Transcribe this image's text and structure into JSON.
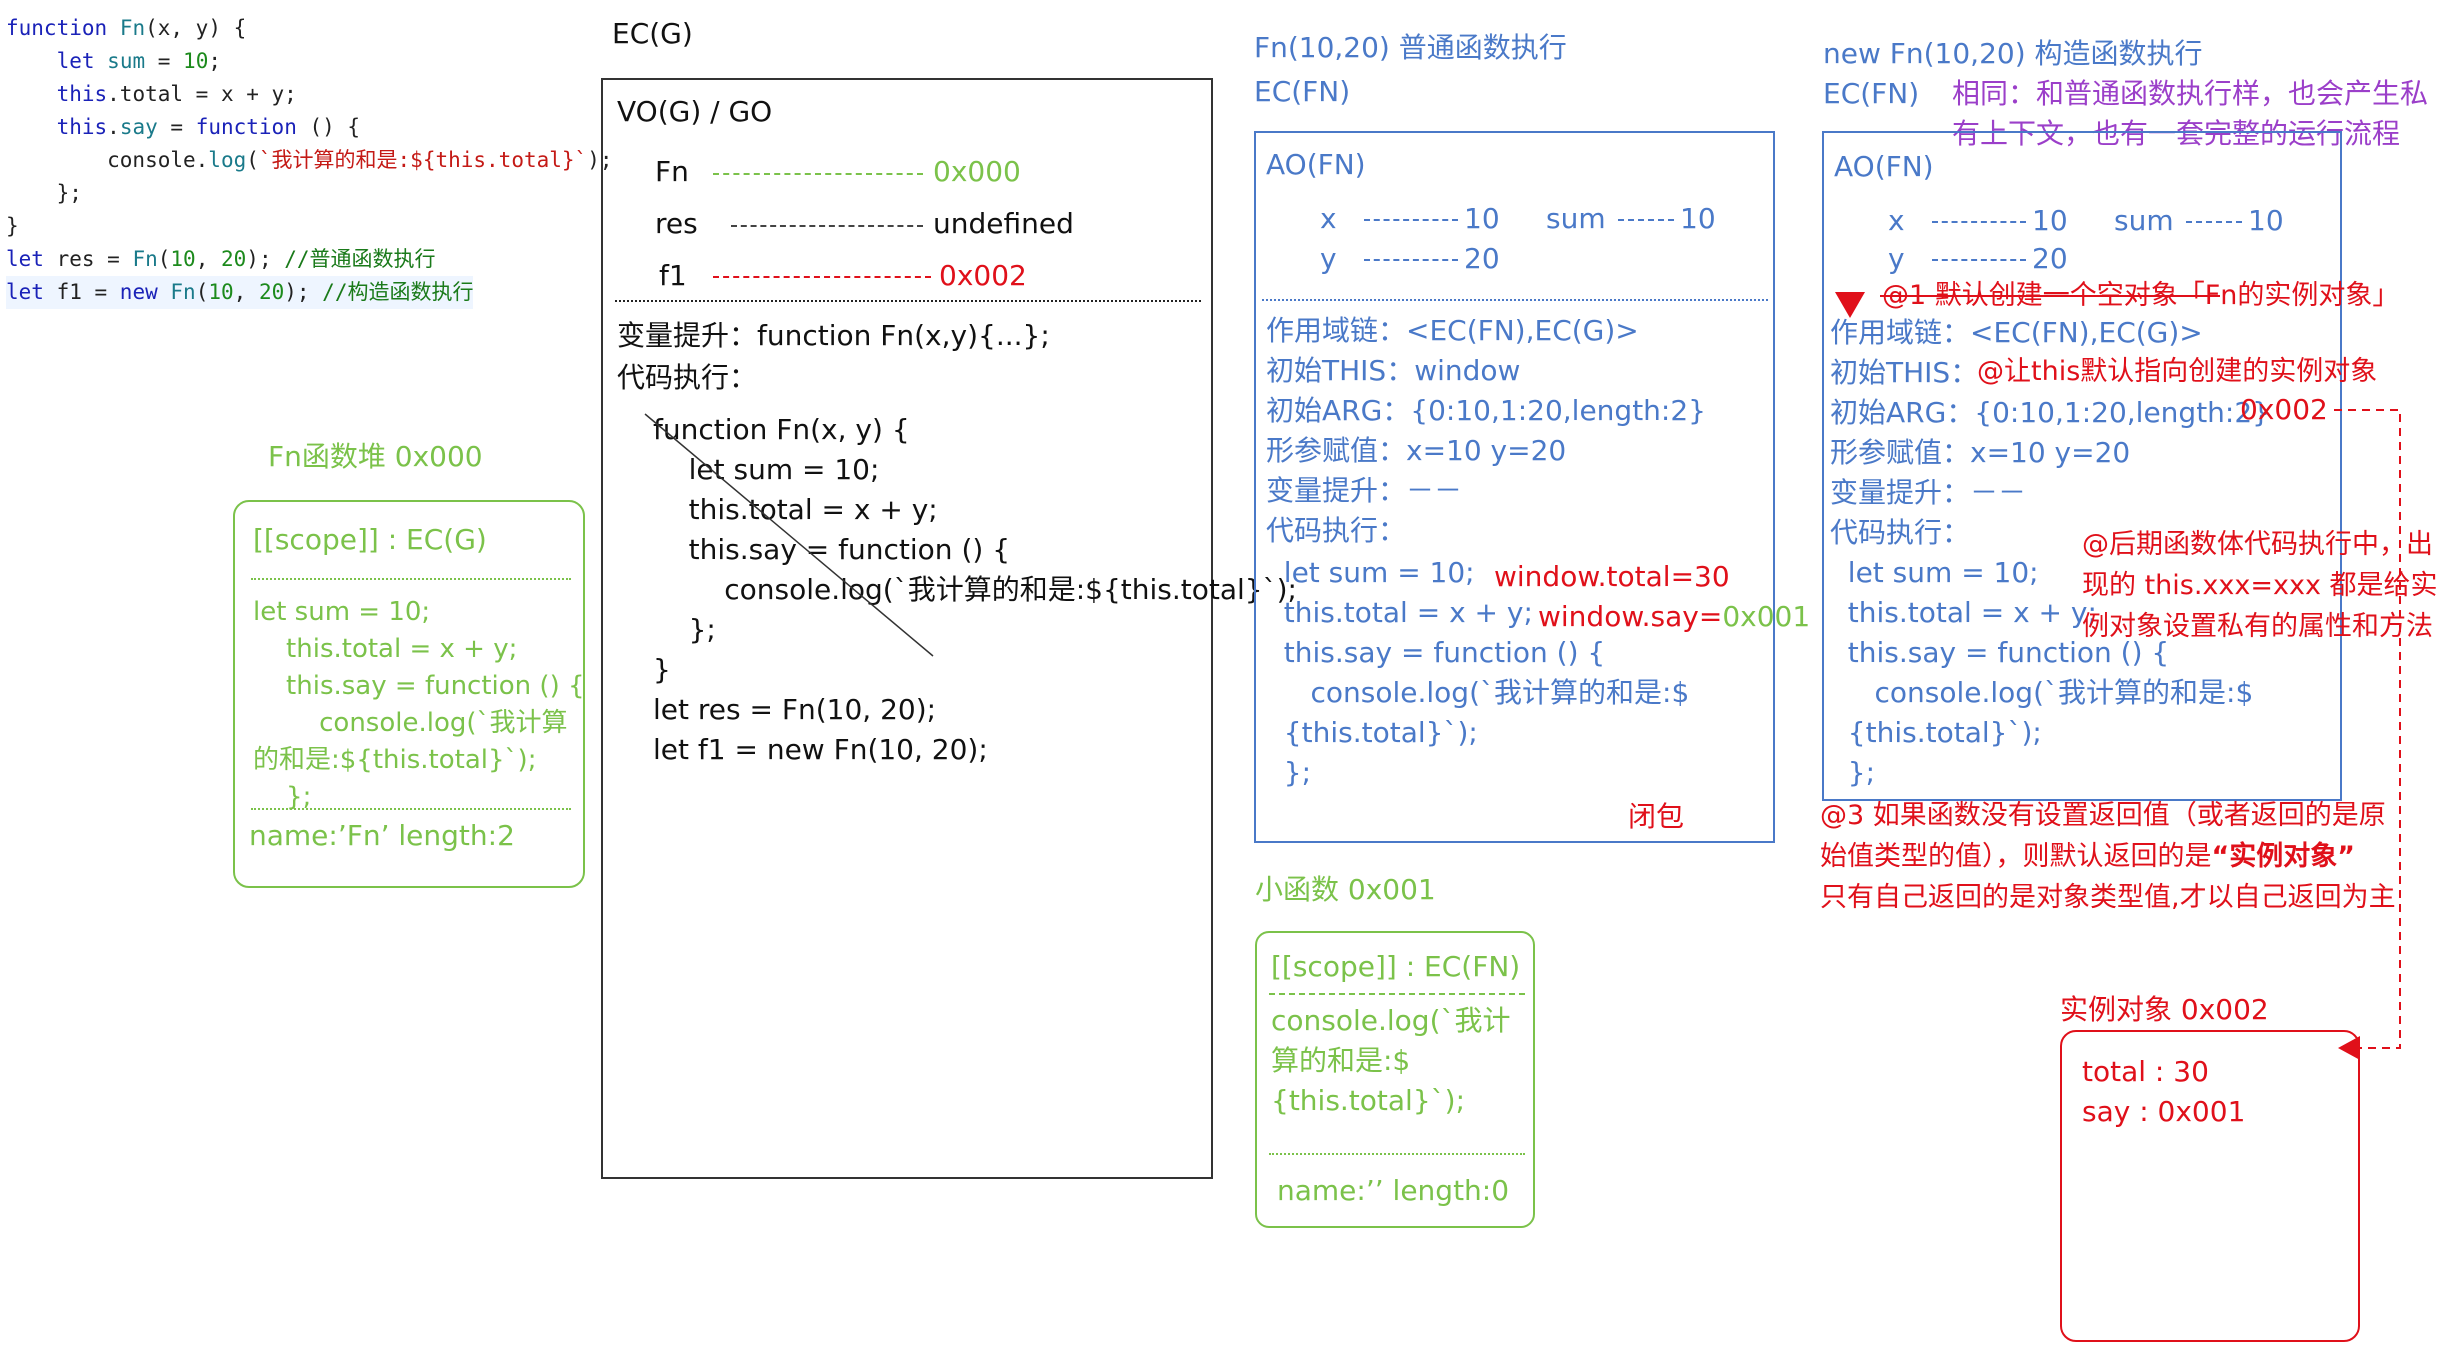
{
  "code": {
    "lines": [
      "function Fn(x, y) {",
      "    let sum = 10;",
      "    this.total = x + y;",
      "    this.say = function () {",
      "        console.log(`我计算的和是:${this.total}`);",
      "    };",
      "}",
      "let res = Fn(10, 20); //普通函数执行",
      "let f1 = new Fn(10, 20); //构造函数执行"
    ]
  },
  "ecg": {
    "title": "EC(G)",
    "vo_title": "VO(G) / GO",
    "vars": [
      {
        "name": "Fn",
        "value": "0x000"
      },
      {
        "name": "res",
        "value": "undefined"
      },
      {
        "name": "f1",
        "value": "0x002"
      }
    ],
    "hoist": "变量提升：function Fn(x,y){...};",
    "exec_label": "代码执行：",
    "exec_code": "function Fn(x, y) {\n    let sum = 10;\n    this.total = x + y;\n    this.say = function () {\n        console.log(`我计算的和是:${this.total}`);\n    };\n}\nlet res = Fn(10, 20);\nlet f1 = new Fn(10, 20);"
  },
  "fn_heap": {
    "title": "Fn函数堆    0x000",
    "scope": "[[scope]] : EC(G)",
    "body": "let sum = 10;\n    this.total = x + y;\n    this.say = function () {\n        console.log(`我计算\n的和是:${this.total}`);\n    };",
    "meta": "name:’Fn’    length:2"
  },
  "normal": {
    "title": "Fn(10,20)   普通函数执行",
    "ec": "EC(FN)",
    "ao": "AO(FN)",
    "x_label": "x",
    "x_val": "10",
    "sum_label": "sum",
    "sum_val": "10",
    "y_label": "y",
    "y_val": "20",
    "lines": [
      "作用域链：<EC(FN),EC(G)>",
      "初始THIS：window",
      "初始ARG：{0:10,1:20,length:2}",
      "形参赋值：x=10   y=20",
      "变量提升：－－",
      "代码执行："
    ],
    "code": "  let sum = 10;\n  this.total = x + y;\n  this.say = function () {\n     console.log(`我计算的和是:$\n  {this.total}`);\n  };",
    "note_total": "window.total=30",
    "note_say": "window.say=",
    "note_say_addr": "0x001",
    "closure": "闭包"
  },
  "small_fn": {
    "title": "小函数 0x001",
    "scope": "[[scope]] : EC(FN)",
    "body": "console.log(`我计\n算的和是:$\n{this.total}`);",
    "meta": "name:’’   length:0"
  },
  "construct": {
    "title": "new Fn(10,20)   构造函数执行",
    "ec": "EC(FN)",
    "same_note": "相同：和普通函数执行样，也会产生私\n有上下文，也有一套完整的运行流程",
    "ao": "AO(FN)",
    "x_label": "x",
    "x_val": "10",
    "sum_label": "sum",
    "sum_val": "10",
    "y_label": "y",
    "y_val": "20",
    "note1": "@1 默认创建一个空对象「Fn的实例对象」",
    "scope_line": "作用域链：<EC(FN),EC(G)>",
    "this_label": "初始THIS：",
    "this_note": "@让this默认指向创建的实例对象",
    "arg_line": "初始ARG：{0:10,1:20,length:2}",
    "arg_addr": "0x002",
    "param_line": "形参赋值：x=10   y=20",
    "hoist_line": "变量提升：－－",
    "exec_line": "代码执行：",
    "code": "  let sum = 10;\n  this.total = x + y;\n  this.say = function () {\n     console.log(`我计算的和是:$\n  {this.total}`);\n  };",
    "note2": "@后期函数体代码执行中，出\n现的 this.xxx=xxx 都是给实\n例对象设置私有的属性和方法",
    "note3_a": "@3 如果函数没有设置返回值（或者返回的是原\n始值类型的值），则默认返回的是",
    "note3_b": "“实例对象”",
    "note3_c": "只有自己返回的是对象类型值,才以自己返回为主"
  },
  "instance": {
    "title": "实例对象  0x002",
    "total": "total : 30",
    "say": "say : 0x001"
  },
  "colors": {
    "green": "#7bc24a",
    "blue": "#4a79c8",
    "red": "#e0101a",
    "purple": "#9b3fc9"
  }
}
